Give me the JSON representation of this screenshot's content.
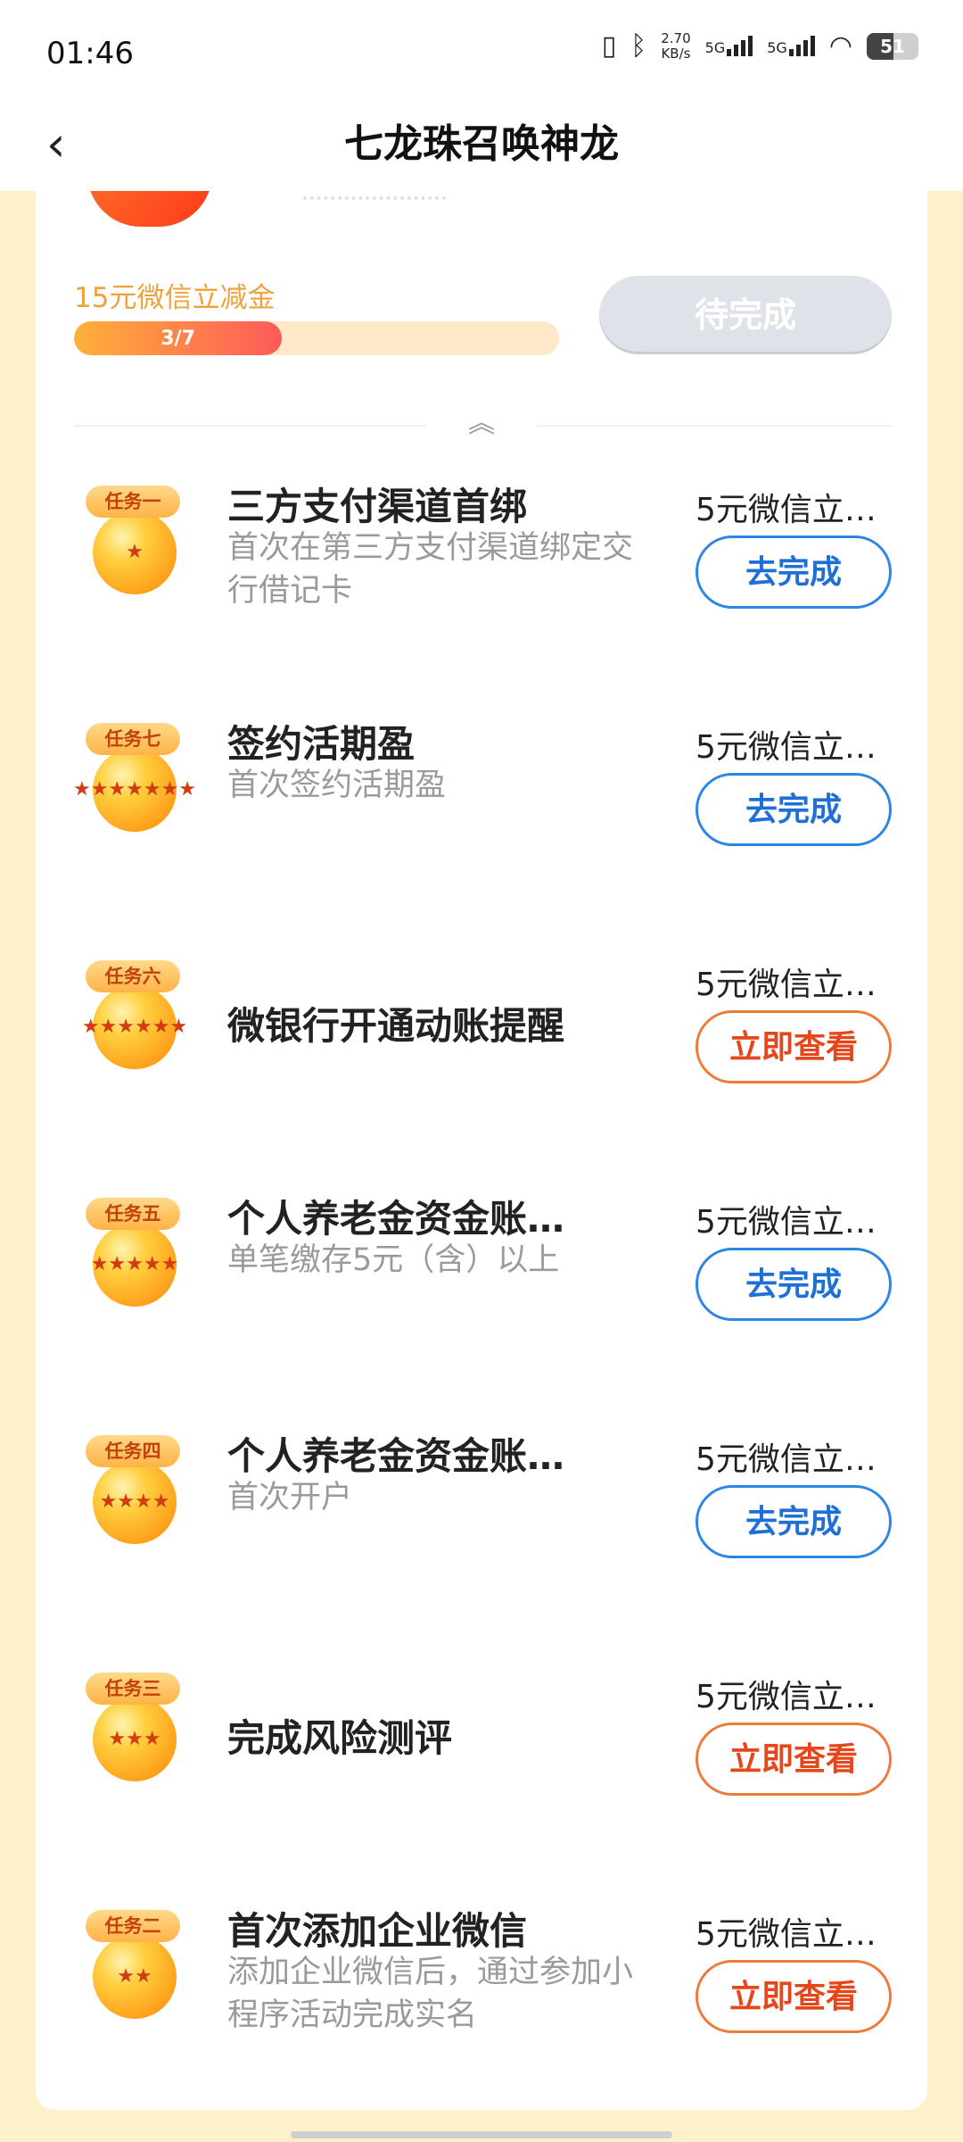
{
  "status_bar": {
    "time": "01:46",
    "netspeed_value": "2.70",
    "netspeed_unit": "KB/s",
    "sim1": "5G",
    "sim2": "5G",
    "battery": "51",
    "battery_level": 0.51
  },
  "header": {
    "back_icon": "chevron-left-icon",
    "title": "七龙珠召唤神龙"
  },
  "summary": {
    "reward_label": "15元微信立减金",
    "progress_text": "3/7",
    "progress_fraction": 0.4286,
    "status_button": "待完成",
    "collapse_icon": "double-chevron-up-icon"
  },
  "tasks": [
    {
      "badge": "任务一",
      "stars": "★",
      "title": "三方支付渠道首绑",
      "desc": "首次在第三方支付渠道绑定交行借记卡",
      "reward": "5元微信立…",
      "action": "去完成",
      "action_style": "blue"
    },
    {
      "badge": "任务七",
      "stars": "★★★★★★★",
      "title": "签约活期盈",
      "desc": "首次签约活期盈",
      "reward": "5元微信立…",
      "action": "去完成",
      "action_style": "blue"
    },
    {
      "badge": "任务六",
      "stars": "★★★★★★",
      "title": "微银行开通动账提醒",
      "desc": "",
      "reward": "5元微信立…",
      "action": "立即查看",
      "action_style": "orange"
    },
    {
      "badge": "任务五",
      "stars": "★★★★★",
      "title": "个人养老金资金账…",
      "desc": "单笔缴存5元（含）以上",
      "reward": "5元微信立…",
      "action": "去完成",
      "action_style": "blue"
    },
    {
      "badge": "任务四",
      "stars": "★★★★",
      "title": "个人养老金资金账…",
      "desc": "首次开户",
      "reward": "5元微信立…",
      "action": "去完成",
      "action_style": "blue"
    },
    {
      "badge": "任务三",
      "stars": "★★★",
      "title": "完成风险测评",
      "desc": "",
      "reward": "5元微信立…",
      "action": "立即查看",
      "action_style": "orange"
    },
    {
      "badge": "任务二",
      "stars": "★★",
      "title": "首次添加企业微信",
      "desc": "添加企业微信后，通过参加小程序活动完成实名",
      "reward": "5元微信立…",
      "action": "立即查看",
      "action_style": "orange"
    }
  ],
  "colors": {
    "page_bg": "#fdf1c9",
    "blue": "#1e6fd6",
    "orange": "#e5461a",
    "reward_label": "#f0a23a"
  }
}
